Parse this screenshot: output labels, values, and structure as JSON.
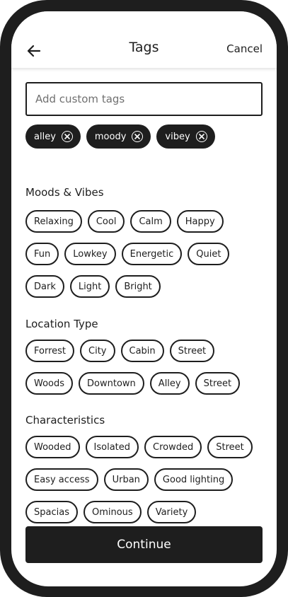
{
  "header": {
    "title": "Tags",
    "cancel_label": "Cancel"
  },
  "search": {
    "placeholder": "Add custom tags",
    "value": ""
  },
  "selected_tags": [
    "alley",
    "moody",
    "vibey"
  ],
  "sections": [
    {
      "title": "Moods & Vibes",
      "rows": [
        [
          "Relaxing",
          "Cool",
          "Calm",
          "Happy"
        ],
        [
          "Fun",
          "Lowkey",
          "Energetic",
          "Quiet"
        ],
        [
          "Dark",
          "Light",
          "Bright"
        ]
      ]
    },
    {
      "title": "Location Type",
      "rows": [
        [
          "Forrest",
          "City",
          "Cabin",
          "Street"
        ],
        [
          "Woods",
          "Downtown",
          "Alley",
          "Street"
        ]
      ]
    },
    {
      "title": "Characteristics",
      "rows": [
        [
          "Wooded",
          "Isolated",
          "Crowded",
          "Street"
        ],
        [
          "Easy access",
          "Urban",
          "Good lighting"
        ],
        [
          "Spacias",
          "Ominous",
          "Variety"
        ]
      ]
    }
  ],
  "footer": {
    "continue_label": "Continue"
  },
  "colors": {
    "frame": "#1e1e1e",
    "background": "#ffffff",
    "placeholder": "#707070"
  }
}
